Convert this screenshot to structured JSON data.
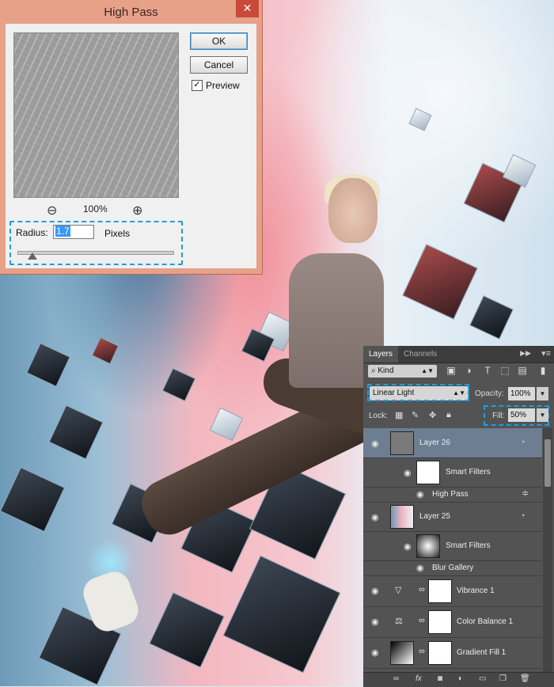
{
  "dialog": {
    "title": "High Pass",
    "close": "✕",
    "zoom_out": "⊖",
    "zoom_level": "100%",
    "zoom_in": "⊕",
    "ok": "OK",
    "cancel": "Cancel",
    "preview_checked": "✓",
    "preview": "Preview",
    "radius_label": "Radius:",
    "radius_value": "1.7",
    "radius_unit": "Pixels"
  },
  "layers": {
    "tabs": [
      "Layers",
      "Channels"
    ],
    "kind": "⌕ Kind",
    "blend_mode": "Linear Light",
    "opacity_label": "Opacity:",
    "opacity": "100%",
    "lock_label": "Lock:",
    "fill_label": "Fill:",
    "fill": "50%",
    "rows": [
      {
        "name": "Layer 26"
      },
      {
        "name": "Smart Filters"
      },
      {
        "name": "High Pass"
      },
      {
        "name": "Layer 25"
      },
      {
        "name": "Smart Filters"
      },
      {
        "name": "Blur Gallery"
      },
      {
        "name": "Vibrance 1"
      },
      {
        "name": "Color Balance 1"
      },
      {
        "name": "Gradient Fill 1"
      }
    ]
  },
  "colors": {
    "dialog_frame": "#e6a188",
    "close_button": "#c94a3a",
    "highlight": "#1a9fe0",
    "selected_layer": "#6d7d92"
  }
}
